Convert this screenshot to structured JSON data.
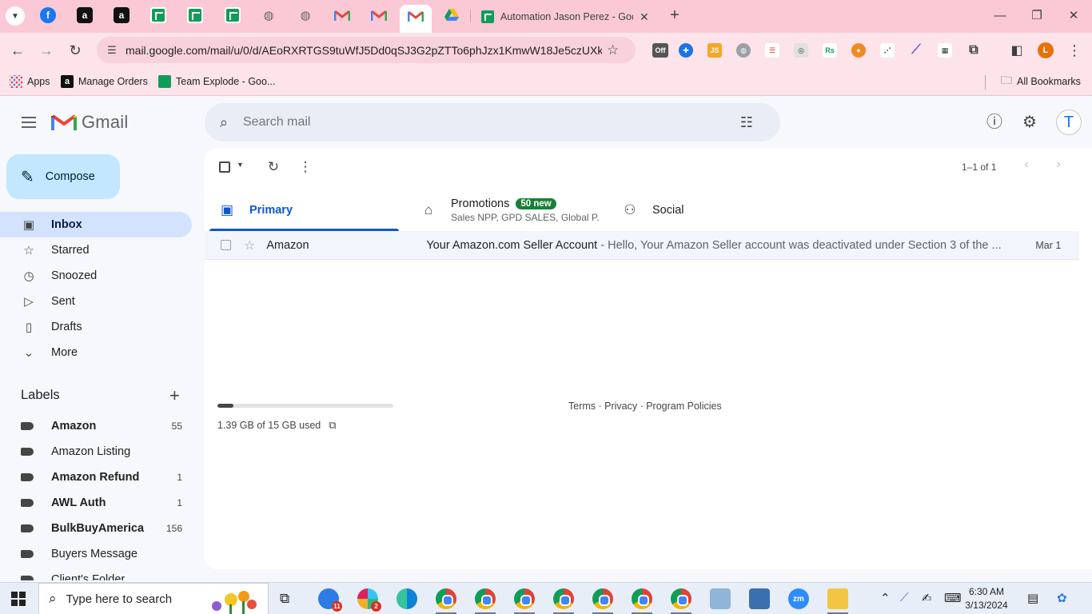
{
  "browser": {
    "active_tab_title": "Automation Jason Perez - Goog",
    "url": "mail.google.com/mail/u/0/d/AEoRXRTGS9tuWfJ5Dd0qSJ3G2pZTTo6phJzx1KmwW18Je5czUXkd...",
    "profile_initial": "L",
    "extension_off_label": "Off",
    "extension_js_label": "JS",
    "extension_rs_label": "Rs",
    "bookmarks": [
      {
        "label": "Apps"
      },
      {
        "label": "Manage Orders"
      },
      {
        "label": "Team Explode - Goo..."
      }
    ],
    "all_bookmarks": "All Bookmarks"
  },
  "gmail": {
    "logo_text": "Gmail",
    "search_placeholder": "Search mail",
    "avatar_initial": "T",
    "compose_label": "Compose",
    "nav": [
      {
        "label": "Inbox",
        "icon": "inbox-icon"
      },
      {
        "label": "Starred",
        "icon": "star-icon"
      },
      {
        "label": "Snoozed",
        "icon": "clock-icon"
      },
      {
        "label": "Sent",
        "icon": "send-icon"
      },
      {
        "label": "Drafts",
        "icon": "draft-icon"
      },
      {
        "label": "More",
        "icon": "chevron-down-icon"
      }
    ],
    "labels_title": "Labels",
    "labels": [
      {
        "name": "Amazon",
        "count": "55",
        "bold": true
      },
      {
        "name": "Amazon Listing",
        "count": "",
        "bold": false
      },
      {
        "name": "Amazon Refund",
        "count": "1",
        "bold": true
      },
      {
        "name": "AWL Auth",
        "count": "1",
        "bold": true
      },
      {
        "name": "BulkBuyAmerica",
        "count": "156",
        "bold": true
      },
      {
        "name": "Buyers Message",
        "count": "",
        "bold": false
      },
      {
        "name": "Client's Folder",
        "count": "",
        "bold": false
      }
    ],
    "pager": "1–1 of 1",
    "tabs": {
      "primary": "Primary",
      "promotions": "Promotions",
      "promotions_badge": "50 new",
      "promotions_sub": "Sales NPP, GPD SALES, Global P...",
      "social": "Social"
    },
    "emails": [
      {
        "sender": "Amazon",
        "subject": "Your Amazon.com Seller Account",
        "snippet": " - Hello, Your Amazon Seller account was deactivated under Section 3 of the ...",
        "date": "Mar 1"
      }
    ],
    "storage": {
      "text": "1.39 GB of 15 GB used",
      "used_fraction": 0.093
    },
    "footer": "Terms · Privacy · Program Policies"
  },
  "taskbar": {
    "search_text": "Type here to search",
    "badges": {
      "mail": "11",
      "slack": "2"
    },
    "time": "6:30 AM",
    "date": "3/13/2024"
  },
  "colors": {
    "chrome_tabstrip": "#fbc9d6",
    "chrome_toolbar": "#fde3ea",
    "gmail_accent": "#0b57d0",
    "compose_bg": "#c2e7ff",
    "inbox_active": "#d3e3fd",
    "promo_green": "#188038"
  }
}
